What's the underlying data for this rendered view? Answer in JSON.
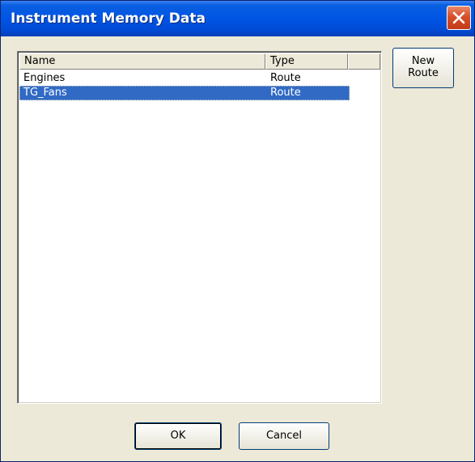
{
  "window": {
    "title": "Instrument Memory Data"
  },
  "list": {
    "columns": [
      "Name",
      "Type"
    ],
    "rows": [
      {
        "name": "Engines",
        "type": "Route",
        "selected": false
      },
      {
        "name": "TG_Fans",
        "type": "Route",
        "selected": true
      }
    ]
  },
  "buttons": {
    "new_route_line1": "New",
    "new_route_line2": "Route",
    "ok": "OK",
    "cancel": "Cancel"
  },
  "colors": {
    "titlebar": "#0055e5",
    "selection": "#316ac5",
    "dialog_bg": "#ece9d8",
    "close_button": "#d6502a"
  },
  "icons": {
    "close": "close-icon"
  }
}
